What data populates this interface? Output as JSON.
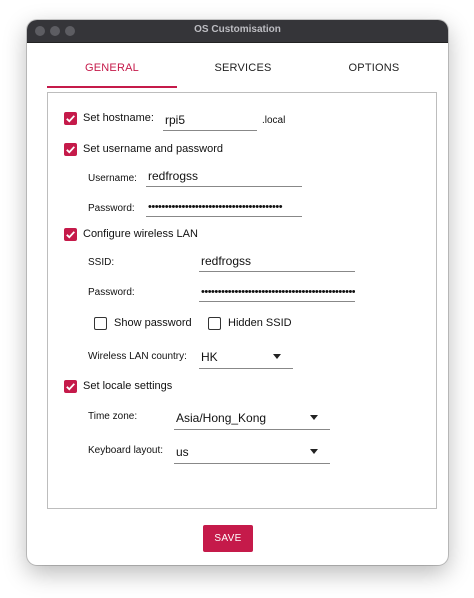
{
  "window": {
    "title": "OS Customisation"
  },
  "tabs": [
    {
      "label": "GENERAL",
      "active": true
    },
    {
      "label": "SERVICES",
      "active": false
    },
    {
      "label": "OPTIONS",
      "active": false
    }
  ],
  "general": {
    "hostname": {
      "label": "Set hostname:",
      "checked": true,
      "value": "rpi5",
      "suffix": ".local"
    },
    "user": {
      "label": "Set username and password",
      "checked": true,
      "username_label": "Username:",
      "username_value": "redfrogss",
      "password_label": "Password:",
      "password_value": "••••••••••••••••••••••••••••••••••••••••"
    },
    "wlan": {
      "label": "Configure wireless LAN",
      "checked": true,
      "ssid_label": "SSID:",
      "ssid_value": "redfrogss",
      "password_label": "Password:",
      "password_value": "••••••••••••••••••••••••••••••••••••••••••••••",
      "show_password_label": "Show password",
      "show_password_checked": false,
      "hidden_ssid_label": "Hidden SSID",
      "hidden_ssid_checked": false,
      "country_label": "Wireless LAN country:",
      "country_value": "HK"
    },
    "locale": {
      "label": "Set locale settings",
      "checked": true,
      "timezone_label": "Time zone:",
      "timezone_value": "Asia/Hong_Kong",
      "keyboard_label": "Keyboard layout:",
      "keyboard_value": "us"
    }
  },
  "save_label": "SAVE",
  "colors": {
    "accent": "#c51a4a",
    "titlebar": "#353539"
  }
}
